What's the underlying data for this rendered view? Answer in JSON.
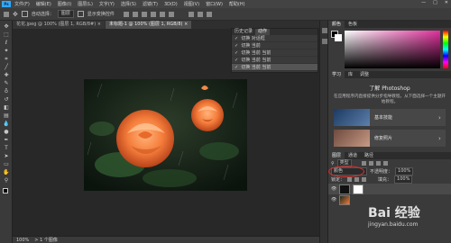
{
  "menubar": {
    "logo": "Ps",
    "items": [
      "文件(F)",
      "编辑(E)",
      "图像(I)",
      "图层(L)",
      "文字(Y)",
      "选择(S)",
      "滤镜(T)",
      "3D(D)",
      "视图(V)",
      "窗口(W)",
      "帮助(H)"
    ],
    "minimize": "—",
    "maximize": "□",
    "close": "✕"
  },
  "options": {
    "auto_select": "自动选择：",
    "layer_select": "图层",
    "show_transform": "显示变换控件"
  },
  "tabs": [
    {
      "label": "花花.jpeg @ 100% (图层 1, RGB/8#) ×",
      "active": false
    },
    {
      "label": "未标题-1 @ 100% (图层 1, RGB/8) ×",
      "active": true
    }
  ],
  "history": {
    "tabs": [
      "历史记录",
      "动作"
    ],
    "rows": [
      "切换 对话框",
      "切换 当前",
      "切换 当前 当前",
      "切换 当前 当前",
      "切换 当前 当前"
    ],
    "selected_index": 4
  },
  "status": {
    "zoom": "100%",
    "info": "> 1 个图像"
  },
  "right": {
    "color_tabs": [
      "颜色",
      "色板"
    ],
    "learn_tabs": [
      "学习",
      "库",
      "调整"
    ],
    "learn_title": "了解 Photoshop",
    "learn_desc": "在应用程序内直接提供分步指导教程。从下面选择一个主题开始教程。",
    "cards": [
      {
        "label": "基本技能"
      },
      {
        "label": "修复照片"
      }
    ],
    "layers_tabs": [
      "图层",
      "通道",
      "路径"
    ],
    "kind_label": "类型",
    "blend_mode": "颜色",
    "opacity_label": "不透明度：",
    "opacity_value": "100%",
    "lock_label": "锁定：",
    "fill_label": "填充：",
    "fill_value": "100%"
  },
  "watermark": {
    "text": "Bai 经验",
    "url": "jingyan.baidu.com"
  },
  "colors": {
    "accent": "#31a8ff",
    "annotation": "#e0302e"
  }
}
